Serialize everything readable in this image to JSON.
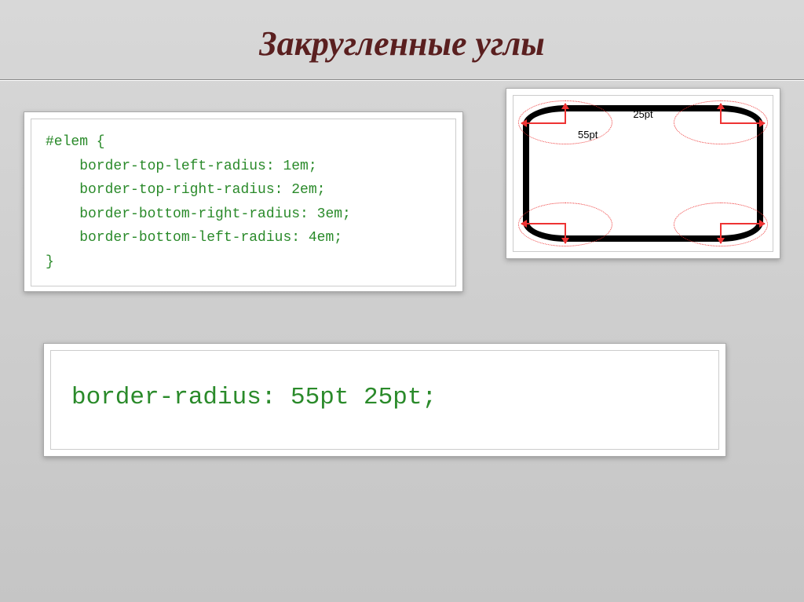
{
  "title": "Закругленные углы",
  "code": {
    "l1": "#elem {",
    "l2": "    border-top-left-radius: 1em;",
    "l3": "    border-top-right-radius: 2em;",
    "l4": "    border-bottom-right-radius: 3em;",
    "l5": "    border-bottom-left-radius: 4em;",
    "l6": "}"
  },
  "shorthand": "border-radius: 55pt 25pt;",
  "diagram": {
    "label25": "25pt",
    "label55": "55pt"
  }
}
